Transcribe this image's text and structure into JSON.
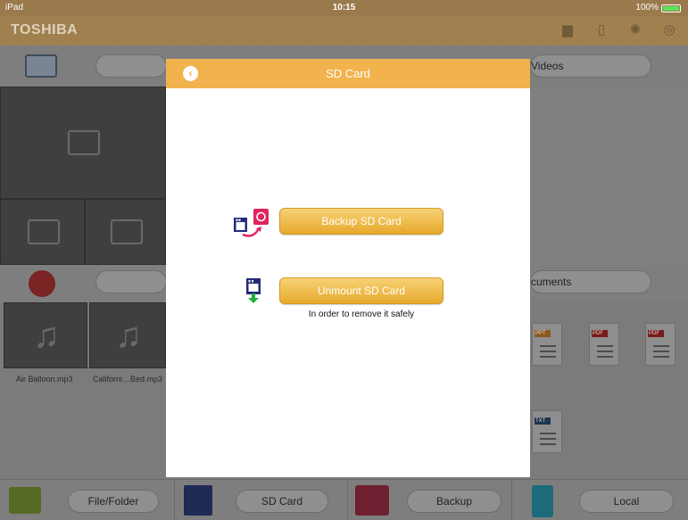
{
  "status_bar": {
    "device": "iPad",
    "time": "10:15",
    "battery": "100%"
  },
  "app": {
    "brand": "TOSHIBA"
  },
  "background": {
    "videos_label": "Videos",
    "documents_label": "cuments",
    "music_files": [
      "Air Balloon.mp3",
      "Californi…Bed.mp3"
    ],
    "doc_tags": [
      "PPT",
      "PDF",
      "PDF",
      "TXT"
    ]
  },
  "modal": {
    "title": "SD Card",
    "backup_label": "Backup SD Card",
    "unmount_label": "Unmount SD Card",
    "unmount_hint": "In order to remove it safely"
  },
  "toolbar": {
    "items": [
      {
        "label": "File/Folder"
      },
      {
        "label": "SD Card"
      },
      {
        "label": "Backup"
      },
      {
        "label": "Local"
      }
    ]
  },
  "colors": {
    "accent": "#f2b24d",
    "button": "#eab33e",
    "brand_bar": "#9e7d4e"
  }
}
